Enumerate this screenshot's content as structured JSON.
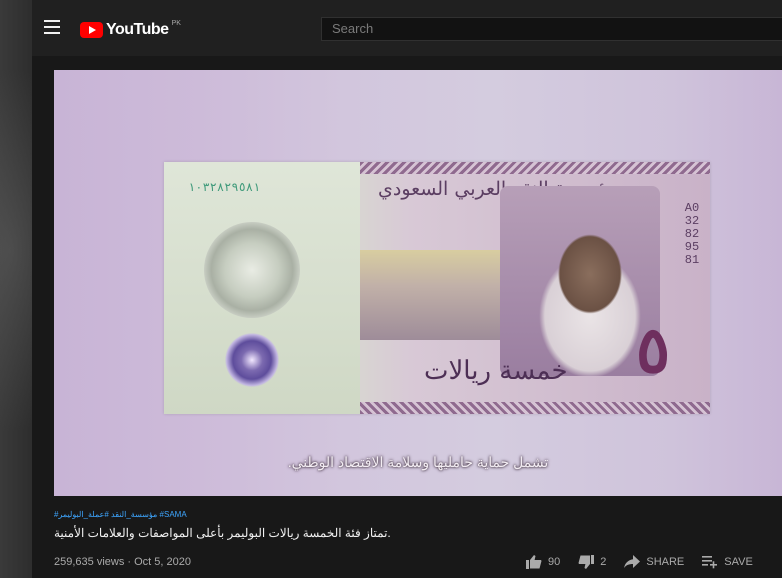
{
  "header": {
    "logo_text": "YouTube",
    "logo_region": "PK",
    "search_placeholder": "Search"
  },
  "video": {
    "caption": "تشمل حماية حامليها وسلامة الاقتصاد الوطني.",
    "banknote": {
      "issuer": "مؤسسة النقد العربي السعودي",
      "denomination_words": "خمسة ريالات",
      "denomination_numeral": "٥",
      "serial_left": "١٠٣٢٨٢٩٥٨١",
      "serial_right": "A0328295 81"
    },
    "hashtags": "#مؤسسة_النقد #عملة_البوليمر #SAMA",
    "title": ".تمتاز فئة الخمسة ريالات البوليمر بأعلى المواصفات والعلامات الأمنية",
    "views": "259,635 views",
    "date": "Oct 5, 2020",
    "likes": "90",
    "dislikes": "2",
    "share_label": "SHARE",
    "save_label": "SAVE"
  },
  "colors": {
    "brand_red": "#ff0000",
    "hashtag_blue": "#3ea6ff",
    "page_bg": "#181818"
  }
}
